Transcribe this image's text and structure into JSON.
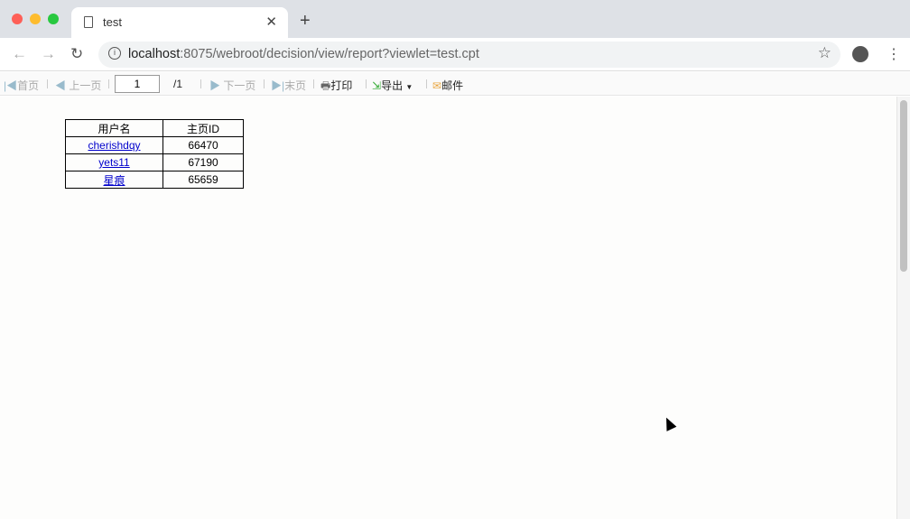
{
  "browser": {
    "tab_title": "test",
    "url_host": "localhost",
    "url_rest": ":8075/webroot/decision/view/report?viewlet=test.cpt"
  },
  "toolbar": {
    "first": "首页",
    "prev": "上一页",
    "page": "1",
    "total": "/1",
    "next": "下一页",
    "last": "末页",
    "print": "打印",
    "export": "导出",
    "mail": "邮件"
  },
  "table": {
    "headers": [
      "用户名",
      "主页ID"
    ],
    "rows": [
      {
        "name": "cherishdqy",
        "id": "66470"
      },
      {
        "name": "yets11",
        "id": "67190"
      },
      {
        "name": "星痕",
        "id": "65659"
      }
    ]
  }
}
